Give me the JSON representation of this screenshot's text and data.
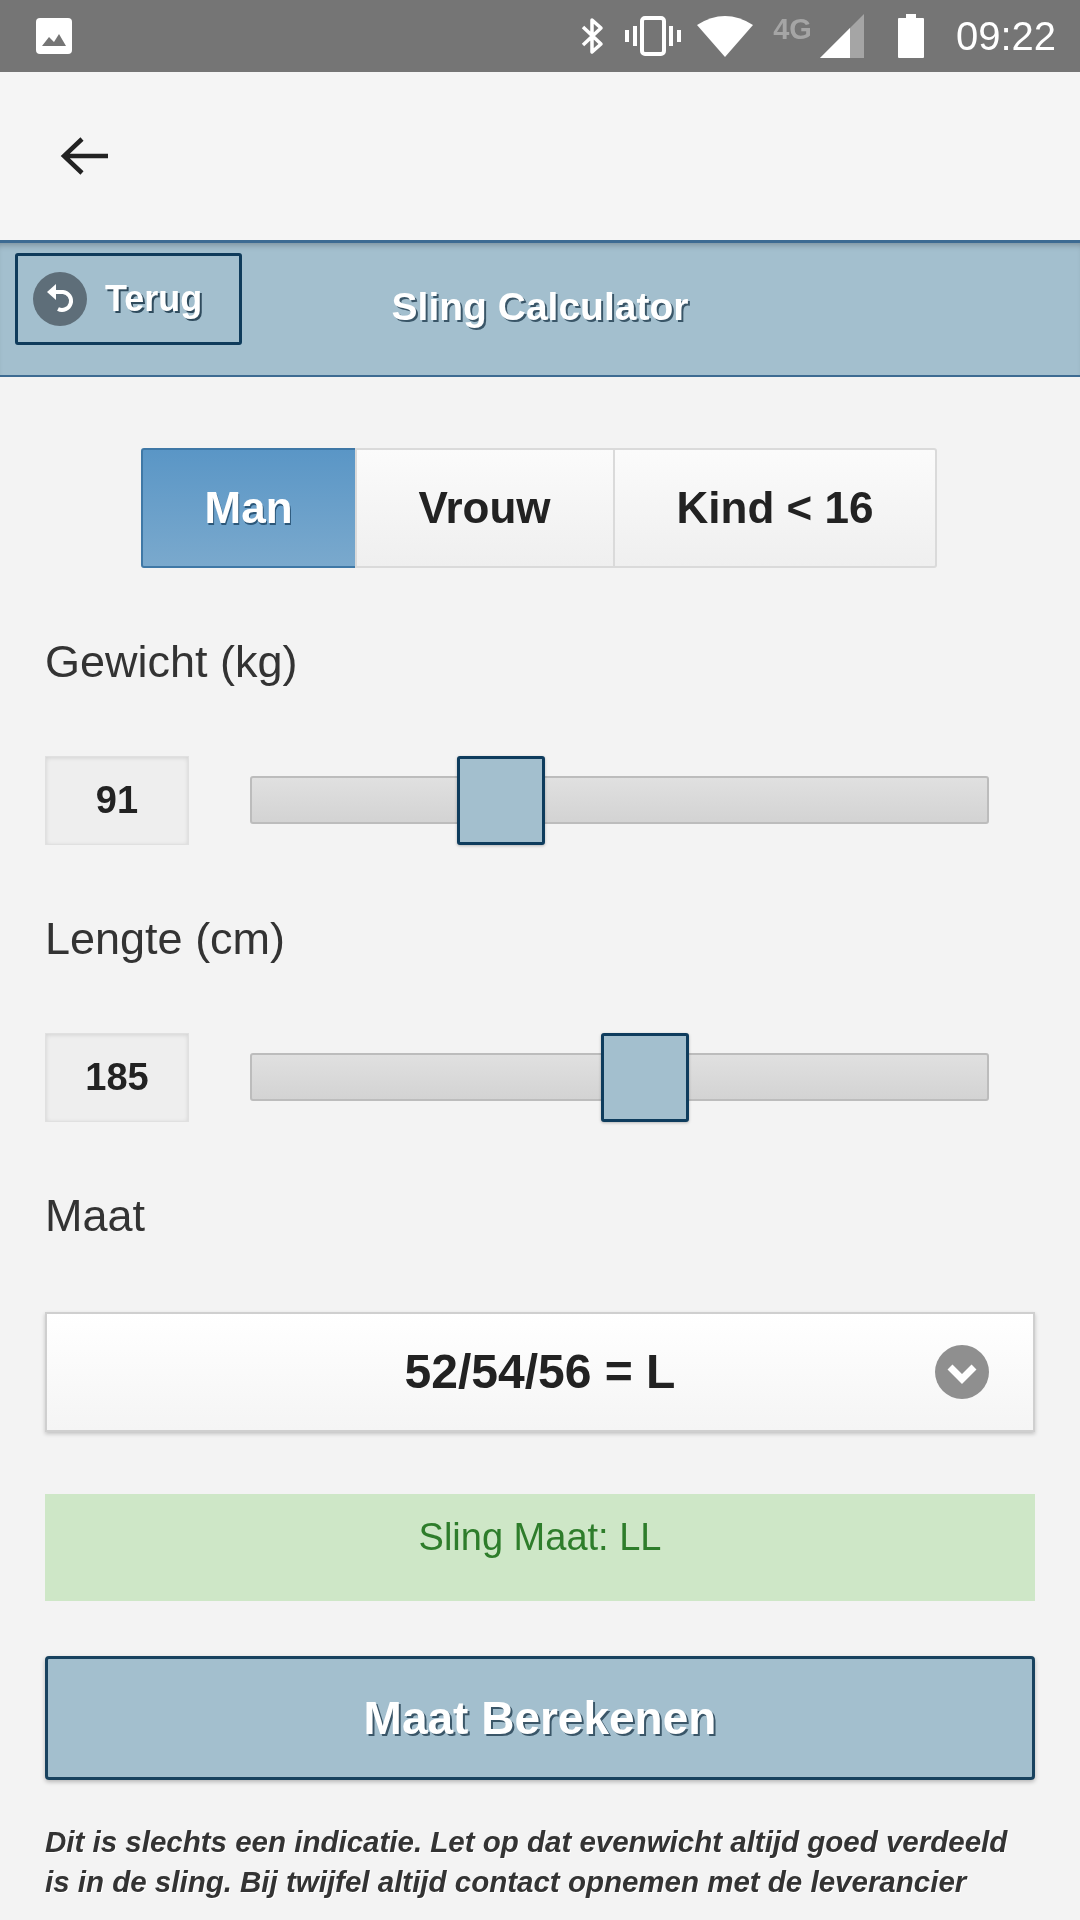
{
  "status_bar": {
    "network": "4G",
    "time": "09:22"
  },
  "header": {
    "back_button": "Terug",
    "title": "Sling Calculator"
  },
  "gender_tabs": [
    {
      "label": "Man",
      "selected": true
    },
    {
      "label": "Vrouw",
      "selected": false
    },
    {
      "label": "Kind < 16",
      "selected": false
    }
  ],
  "sliders": [
    {
      "label": "Gewicht (kg)",
      "value": "91",
      "level": 0.34
    },
    {
      "label": "Lengte (cm)",
      "value": "185",
      "level": 0.534
    }
  ],
  "size": {
    "label": "Maat",
    "value": "52/54/56 = L"
  },
  "result": "Sling Maat: LL",
  "calculate_button": "Maat Berekenen",
  "disclaimer": "Dit is slechts een indicatie. Let op dat evenwicht altijd goed verdeeld is in de sling. Bij twijfel altijd contact opnemen met de leverancier"
}
